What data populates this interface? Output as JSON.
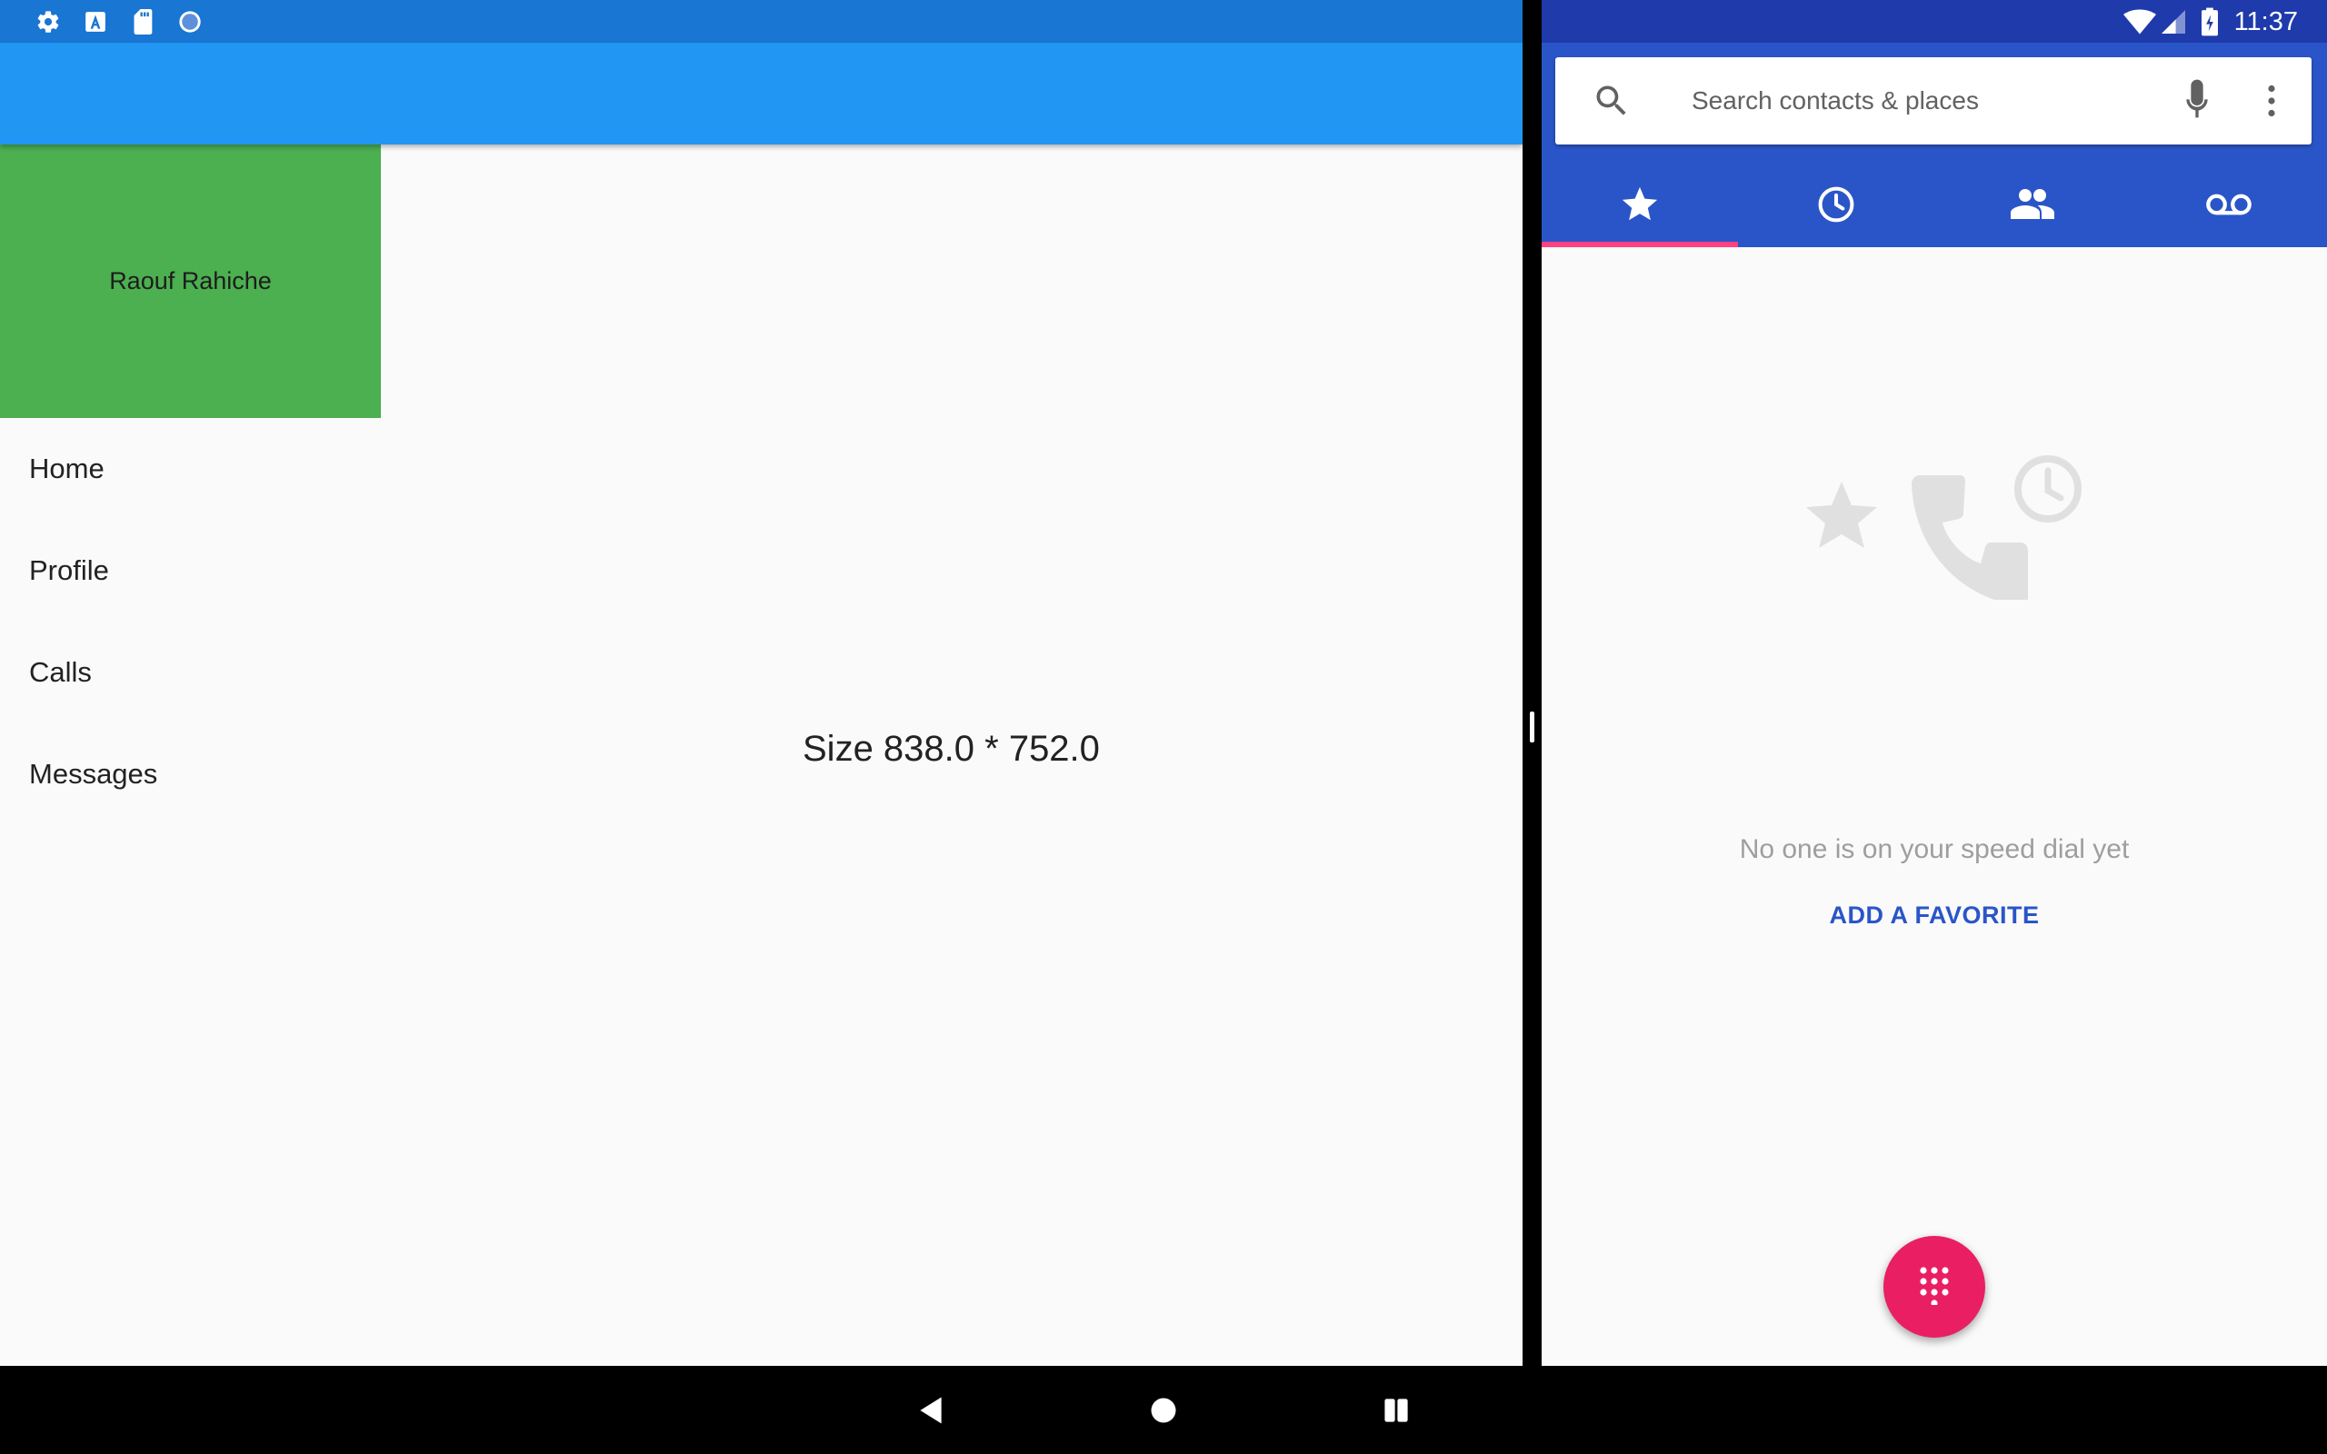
{
  "left_app": {
    "status_icons": [
      "settings-icon",
      "accessibility-a-icon",
      "sd-card-icon",
      "circle-sync-icon"
    ],
    "drawer": {
      "header_name": "Raouf Rahiche",
      "header_color": "#4caf50",
      "items": [
        {
          "label": "Home"
        },
        {
          "label": "Profile"
        },
        {
          "label": "Calls"
        },
        {
          "label": "Messages"
        }
      ]
    },
    "body_text": "Size 838.0 * 752.0",
    "appbar_color": "#2196f3",
    "status_bar_color": "#1976d2"
  },
  "dialer": {
    "status_bar": {
      "time": "11:37",
      "icons": [
        "wifi-icon",
        "cell-signal-icon",
        "battery-charging-icon"
      ]
    },
    "search": {
      "placeholder": "Search contacts & places"
    },
    "tabs": [
      {
        "icon": "star-icon",
        "selected": true
      },
      {
        "icon": "clock-icon",
        "selected": false
      },
      {
        "icon": "contacts-icon",
        "selected": false
      },
      {
        "icon": "voicemail-icon",
        "selected": false
      }
    ],
    "empty_state": {
      "message": "No one is on your speed dial yet",
      "action": "ADD A FAVORITE"
    },
    "fab_icon": "dialpad-icon",
    "header_color": "#2a55c8",
    "accent_color": "#e91e63"
  },
  "navbar": {
    "buttons": [
      "back-icon",
      "home-icon",
      "recents-icon"
    ]
  }
}
